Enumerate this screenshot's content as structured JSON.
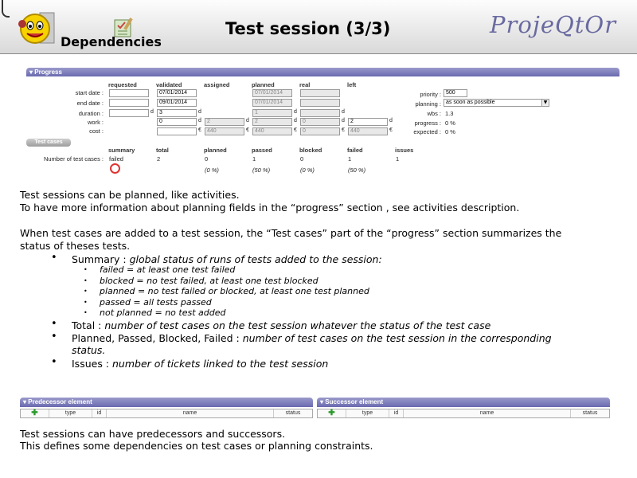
{
  "header": {
    "chapter": "Dependencies",
    "title": "Test session (3/3)",
    "brand": "ProjeQtOr"
  },
  "progress": {
    "section_label": "Progress",
    "columns": [
      "requested",
      "validated",
      "assigned",
      "planned",
      "real",
      "left"
    ],
    "rows": {
      "start_date": "start date :",
      "end_date": "end date :",
      "duration": "duration :",
      "work": "work :",
      "cost": "cost :"
    },
    "values": {
      "validated_start": "07/01/2014",
      "validated_end": "09/01/2014",
      "validated_duration": "3",
      "planned_start": "07/01/2014",
      "planned_end": "07/01/2014",
      "planned_duration": "1",
      "work_validated": "0",
      "work_assigned": "2",
      "work_planned": "2",
      "work_real": "0",
      "work_left": "2",
      "cost_assigned": "440",
      "cost_planned": "440",
      "cost_real": "0",
      "cost_left": "440"
    },
    "units": {
      "day": "d",
      "euro": "€"
    },
    "right": {
      "priority_label": "priority :",
      "priority_value": "500",
      "planning_label": "planning :",
      "planning_value": "as soon as possible",
      "wbs_label": "wbs :",
      "wbs_value": "1.3",
      "progress_label": "progress :",
      "progress_value": "0 %",
      "expected_label": "expected :",
      "expected_value": "0 %"
    }
  },
  "test_cases": {
    "button": "Test cases",
    "headers": [
      "summary",
      "total",
      "planned",
      "passed",
      "blocked",
      "failed",
      "issues"
    ],
    "row_label": "Number of test cases :",
    "values": [
      "failed",
      "2",
      "0",
      "1",
      "0",
      "1",
      "1"
    ],
    "percents": [
      "(0 %)",
      "(50 %)",
      "(0 %)",
      "(50 %)"
    ]
  },
  "text": {
    "p1a": "Test sessions can be planned, like activities.",
    "p1b": "To have more information about planning fields in the “progress” section , see activities description.",
    "p2a": "When test cases are added to a test session, the “Test cases” part of the “progress” section summarizes the",
    "p2b": "status of theses tests.",
    "b1_label": "Summary : ",
    "b1_desc": "global status of runs of tests added to the session:",
    "s1": "failed = at least one test failed",
    "s2": "blocked = no test failed, at least one test blocked",
    "s3": "planned = no test failed or blocked, at least one test planned",
    "s4": "passed = all tests passed",
    "s5": "not planned = no test added",
    "b2_label": "Total : ",
    "b2_desc": "number of test cases on the test session whatever the status of the test case",
    "b3_label": "Planned, Passed, Blocked, Failed : ",
    "b3_desc": "number of test cases on the test session in the corresponding",
    "b3_desc2": "status.",
    "b4_label": "Issues : ",
    "b4_desc": "number of tickets linked to the test session",
    "p3a": "Test sessions can have predecessors and successors.",
    "p3b": "This defines some dependencies on test cases or planning constraints."
  },
  "dependencies": {
    "predecessor_label": "Predecessor element",
    "successor_label": "Successor element",
    "columns": [
      "type",
      "id",
      "name",
      "status"
    ],
    "add_symbol": "✚"
  },
  "colors": {
    "panel": "#7a7ab8",
    "brand": "#6a6aa0"
  }
}
